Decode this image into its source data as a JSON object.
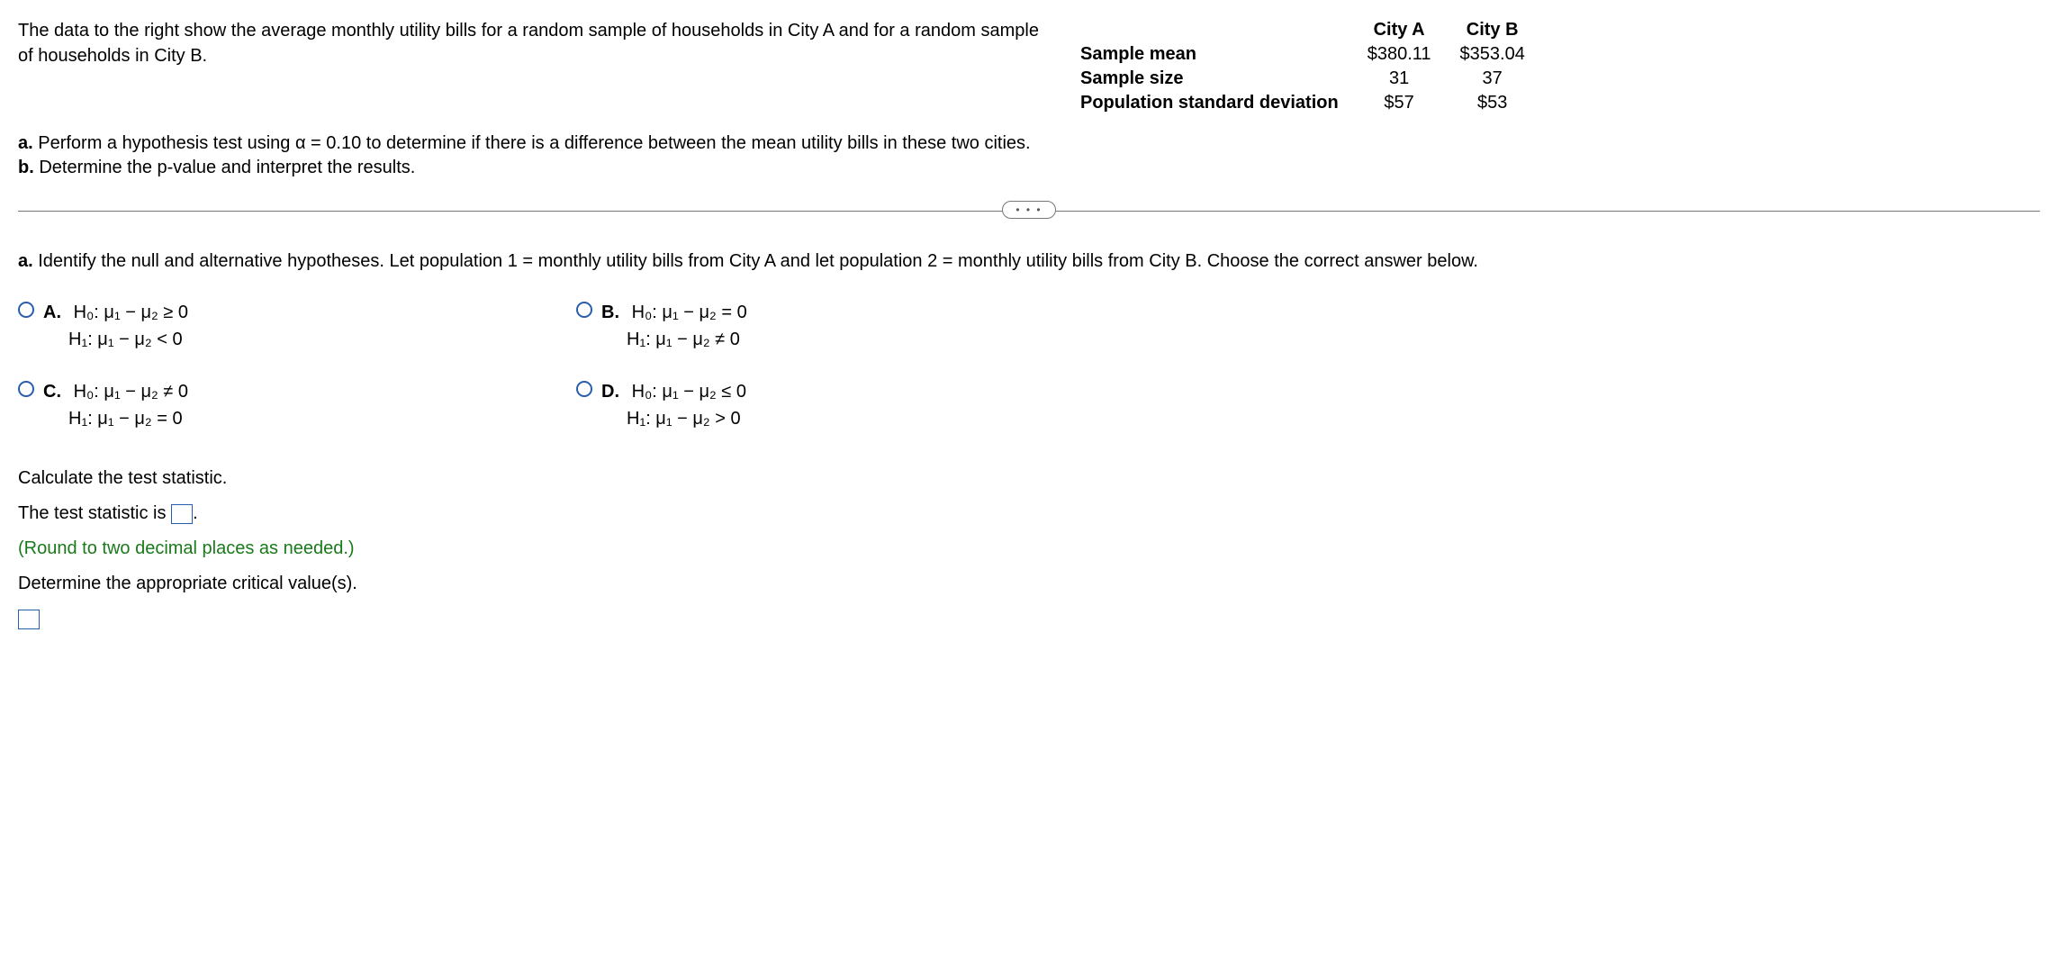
{
  "intro": "The data to the right show the average monthly utility bills for a random sample of households in City A and for a random sample of households in City B.",
  "table": {
    "headers": {
      "blank": "",
      "colA": "City A",
      "colB": "City B"
    },
    "rows": [
      {
        "label": "Sample mean",
        "a": "$380.11",
        "b": "$353.04"
      },
      {
        "label": "Sample size",
        "a": "31",
        "b": "37"
      },
      {
        "label": "Population standard deviation",
        "a": "$57",
        "b": "$53"
      }
    ]
  },
  "tasks": {
    "a_prefix": "a.",
    "a_text": " Perform a hypothesis test using α = 0.10 to determine if there is a difference between the mean utility bills in these two cities.",
    "b_prefix": "b.",
    "b_text": " Determine the p-value and interpret the results."
  },
  "toggle": "• • •",
  "question_a": {
    "prefix": "a.",
    "text": " Identify the null and alternative hypotheses. Let population 1 = monthly utility bills from City A and let population 2 = monthly utility bills from City B. Choose the correct answer below."
  },
  "options": {
    "A": {
      "label": "A.",
      "h0": "H₀: μ₁ − μ₂ ≥ 0",
      "h1": "H₁: μ₁ − μ₂ < 0"
    },
    "B": {
      "label": "B.",
      "h0": "H₀: μ₁ − μ₂ = 0",
      "h1": "H₁: μ₁ − μ₂ ≠ 0"
    },
    "C": {
      "label": "C.",
      "h0": "H₀: μ₁ − μ₂ ≠ 0",
      "h1": "H₁: μ₁ − μ₂ = 0"
    },
    "D": {
      "label": "D.",
      "h0": "H₀: μ₁ − μ₂ ≤ 0",
      "h1": "H₁: μ₁ − μ₂ > 0"
    }
  },
  "section2": {
    "calc": "Calculate the test statistic.",
    "stat_pre": "The test statistic is ",
    "stat_post": ".",
    "round_hint": "(Round to two decimal places as needed.)",
    "crit": "Determine the appropriate critical value(s)."
  }
}
